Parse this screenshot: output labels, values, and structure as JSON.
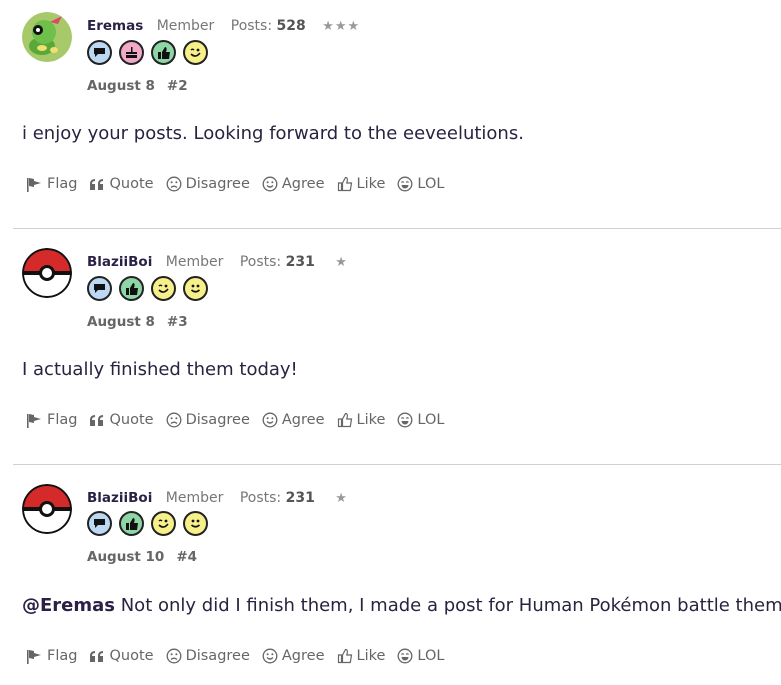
{
  "posts": [
    {
      "author": "Eremas",
      "rank": "Member",
      "posts_label": "Posts:",
      "post_count": "528",
      "stars": "★★★",
      "avatar": "caterpie-avatar",
      "badges": [
        "chat-bubble-icon",
        "cake-icon",
        "thumbs-up-icon",
        "wink-face-icon"
      ],
      "date": "August 8",
      "number": "#2",
      "mention": "",
      "text": "i enjoy your posts. Looking forward to the eeveelutions."
    },
    {
      "author": "BlaziiBoi",
      "rank": "Member",
      "posts_label": "Posts:",
      "post_count": "231",
      "stars": "★",
      "avatar": "pokeball-avatar",
      "badges": [
        "chat-bubble-icon",
        "thumbs-up-icon",
        "wink-face-icon",
        "smile-face-icon"
      ],
      "date": "August 8",
      "number": "#3",
      "mention": "",
      "text": "I actually finished them today!"
    },
    {
      "author": "BlaziiBoi",
      "rank": "Member",
      "posts_label": "Posts:",
      "post_count": "231",
      "stars": "★",
      "avatar": "pokeball-avatar",
      "badges": [
        "chat-bubble-icon",
        "thumbs-up-icon",
        "wink-face-icon",
        "smile-face-icon"
      ],
      "date": "August 10",
      "number": "#4",
      "mention": "@Eremas",
      "text": " Not only did I finish them, I made a post for Human Pokémon battle themes!"
    }
  ],
  "actions": {
    "flag": "Flag",
    "quote": "Quote",
    "disagree": "Disagree",
    "agree": "Agree",
    "like": "Like",
    "lol": "LOL"
  },
  "colors": {
    "badge_blue": "#bcd8f2",
    "badge_pink": "#f2a9c8",
    "badge_green": "#8ed6a6",
    "badge_yellow": "#f7ef8a",
    "pokeball_red": "#d42a2a"
  }
}
